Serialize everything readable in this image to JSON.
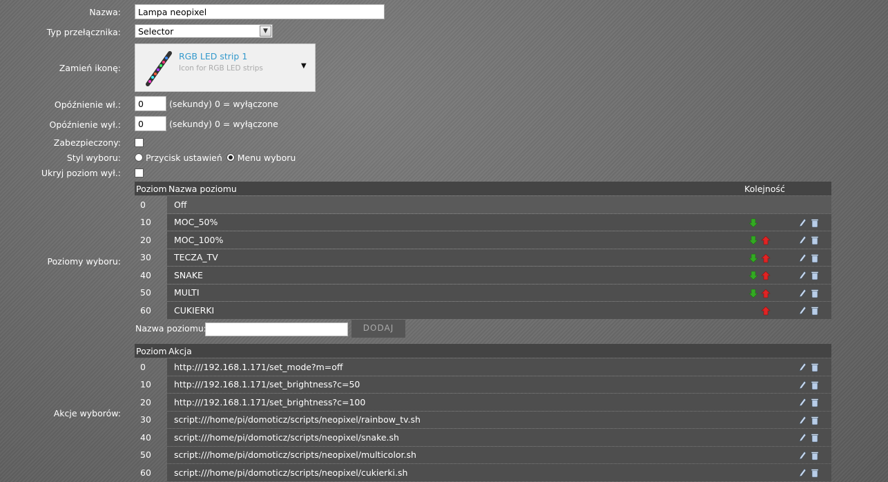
{
  "form": {
    "name_label": "Nazwa:",
    "name_value": "Lampa neopixel",
    "switch_type_label": "Typ przełącznika:",
    "switch_type_value": "Selector",
    "icon_label": "Zamień ikonę:",
    "icon_title": "RGB LED strip 1",
    "icon_subtitle": "Icon for RGB LED strips",
    "on_delay_label": "Opóźnienie wł.:",
    "on_delay_value": "0",
    "on_delay_hint": "(sekundy) 0 = wyłączone",
    "off_delay_label": "Opóźnienie wył.:",
    "off_delay_value": "0",
    "off_delay_hint": "(sekundy) 0 = wyłączone",
    "protected_label": "Zabezpieczony:",
    "style_label": "Styl wyboru:",
    "style_option_1": "Przycisk ustawień",
    "style_option_2": "Menu wyboru",
    "style_selected": "Menu wyboru",
    "hide_off_label": "Ukryj poziom wył.:",
    "levels_label": "Poziomy wyboru:",
    "actions_label": "Akcje wyborów:"
  },
  "levels_table": {
    "headers": [
      "Poziom",
      "Nazwa poziomu",
      "Kolejność"
    ],
    "rows": [
      {
        "level": "0",
        "name": "Off",
        "down": false,
        "up": false,
        "edit": false
      },
      {
        "level": "10",
        "name": "MOC_50%",
        "down": true,
        "up": false,
        "edit": true
      },
      {
        "level": "20",
        "name": "MOC_100%",
        "down": true,
        "up": true,
        "edit": true
      },
      {
        "level": "30",
        "name": "TECZA_TV",
        "down": true,
        "up": true,
        "edit": true
      },
      {
        "level": "40",
        "name": "SNAKE",
        "down": true,
        "up": true,
        "edit": true
      },
      {
        "level": "50",
        "name": "MULTI",
        "down": true,
        "up": true,
        "edit": true
      },
      {
        "level": "60",
        "name": "CUKIERKI",
        "down": false,
        "up": true,
        "edit": true
      }
    ],
    "add_label": "Nazwa poziomu:",
    "add_placeholder": "",
    "add_button": "DODAJ"
  },
  "actions_table": {
    "headers": [
      "Poziom",
      "Akcja"
    ],
    "rows": [
      {
        "level": "0",
        "action": "http:///192.168.1.171/set_mode?m=off"
      },
      {
        "level": "10",
        "action": "http:///192.168.1.171/set_brightness?c=50"
      },
      {
        "level": "20",
        "action": "http:///192.168.1.171/set_brightness?c=100"
      },
      {
        "level": "30",
        "action": "script:///home/pi/domoticz/scripts/neopixel/rainbow_tv.sh"
      },
      {
        "level": "40",
        "action": "script:///home/pi/domoticz/scripts/neopixel/snake.sh"
      },
      {
        "level": "50",
        "action": "script:///home/pi/domoticz/scripts/neopixel/multicolor.sh"
      },
      {
        "level": "60",
        "action": "script:///home/pi/domoticz/scripts/neopixel/cukierki.sh"
      }
    ]
  },
  "colors": {
    "accent": "#3399cc",
    "down_arrow": "#33aa22",
    "up_arrow": "#dd2222",
    "row_bg": "#4e4e4e",
    "header_bg": "#444444"
  },
  "icons": {
    "down": "arrow-down-icon",
    "up": "arrow-up-icon",
    "edit": "pencil-icon",
    "delete": "trash-icon"
  }
}
